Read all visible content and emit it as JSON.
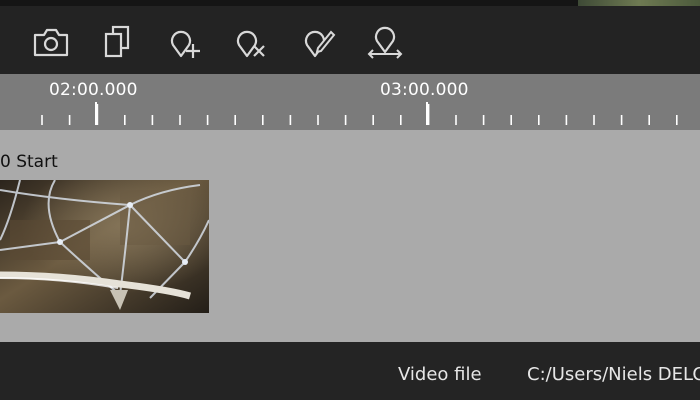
{
  "toolbar": {
    "buttons": [
      {
        "name": "snapshot",
        "icon": "camera-icon"
      },
      {
        "name": "copy",
        "icon": "copy-icon"
      },
      {
        "name": "add-marker",
        "icon": "marker-add-icon"
      },
      {
        "name": "remove-marker",
        "icon": "marker-remove-icon"
      },
      {
        "name": "edit-marker",
        "icon": "marker-edit-icon"
      },
      {
        "name": "move-marker",
        "icon": "marker-move-icon"
      }
    ],
    "icon_color": "#d8d8d8"
  },
  "ruler": {
    "major_labels": [
      "02:00.000",
      "03:00.000"
    ]
  },
  "track": {
    "clip_label": "0 Start",
    "clip_thumbnail": "spherical-cage-video-frame"
  },
  "status": {
    "label": "Video file",
    "value": "C:/Users/Niels DELO"
  },
  "colors": {
    "background": "#232323",
    "ruler": "#7b7b7b",
    "track": "#aaaaaa",
    "text_light": "#ffffff"
  }
}
